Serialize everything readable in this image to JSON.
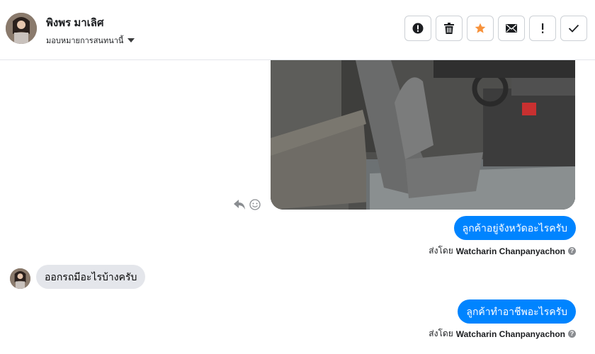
{
  "header": {
    "contact_name": "พิงพร มาเลิศ",
    "assign_label": "มอบหมายการสนทนานี้",
    "actions": [
      {
        "icon": "alert-circle-icon"
      },
      {
        "icon": "trash-icon"
      },
      {
        "icon": "star-icon",
        "color": "#f7923b"
      },
      {
        "icon": "envelope-icon"
      },
      {
        "icon": "exclamation-icon"
      },
      {
        "icon": "check-icon"
      }
    ]
  },
  "messages": [
    {
      "direction": "outgoing",
      "type": "image"
    },
    {
      "direction": "outgoing",
      "text": "ลูกค้าอยู่จังหวัดอะไรครับ",
      "sent_by_prefix": "ส่งโดย",
      "sent_by_name": "Watcharin Chanpanyachon"
    },
    {
      "direction": "incoming",
      "text": "ออกรถมีอะไรบ้างครับ"
    },
    {
      "direction": "outgoing",
      "text": "ลูกค้าทำอาชีพอะไรครับ",
      "sent_by_prefix": "ส่งโดย",
      "sent_by_name": "Watcharin Chanpanyachon"
    }
  ],
  "colors": {
    "outgoing_bubble": "#0084ff",
    "incoming_bubble": "#e4e6eb",
    "star": "#f7923b"
  }
}
